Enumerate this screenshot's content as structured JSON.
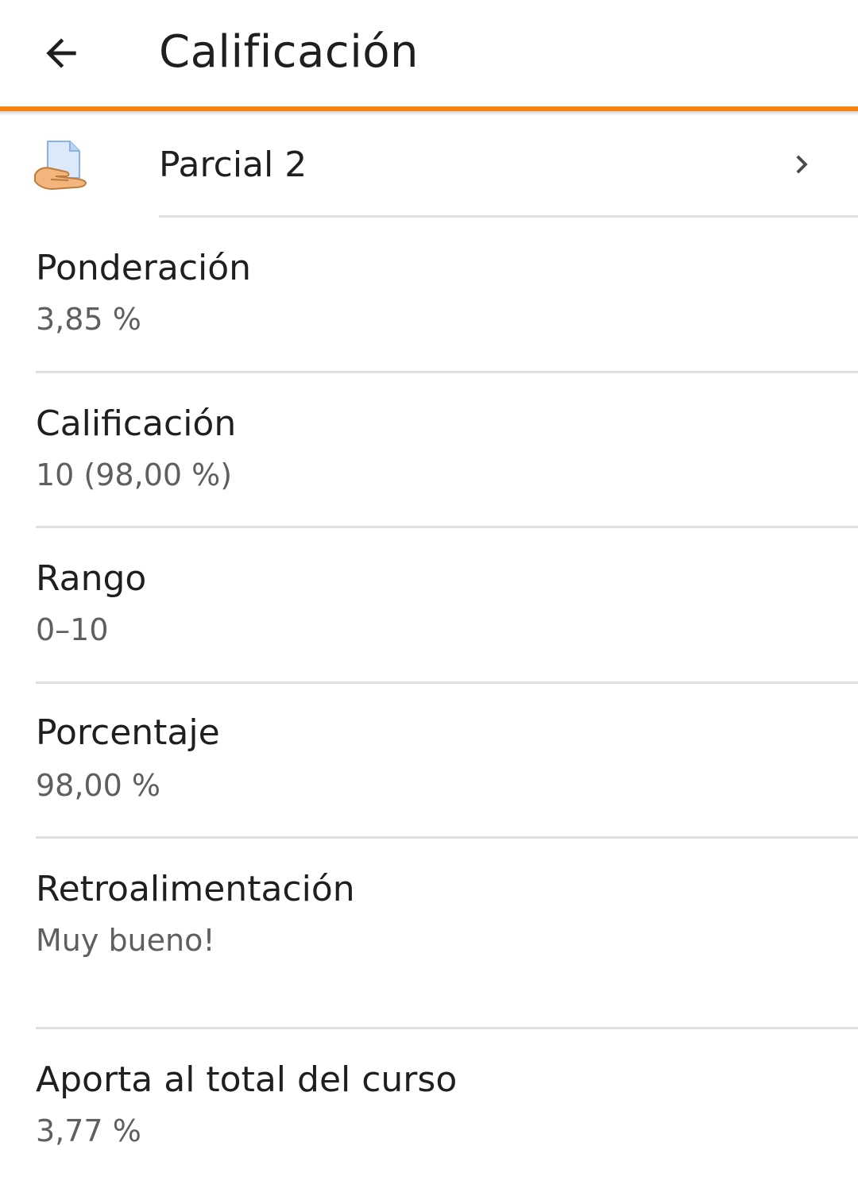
{
  "header": {
    "title": "Calificación",
    "back_icon": "arrow-back-icon",
    "accent_color": "#f98012"
  },
  "item": {
    "label": "Parcial 2",
    "icon": "assignment-icon",
    "chevron_icon": "chevron-right-icon"
  },
  "fields": [
    {
      "label": "Ponderación",
      "value": "3,85 %"
    },
    {
      "label": "Calificación",
      "value": "10 (98,00 %)"
    },
    {
      "label": "Rango",
      "value": "0–10"
    },
    {
      "label": "Porcentaje",
      "value": "98,00 %"
    },
    {
      "label": "Retroalimentación",
      "value": "Muy bueno!"
    },
    {
      "label": "Aporta al total del curso",
      "value": "3,77 %"
    }
  ]
}
